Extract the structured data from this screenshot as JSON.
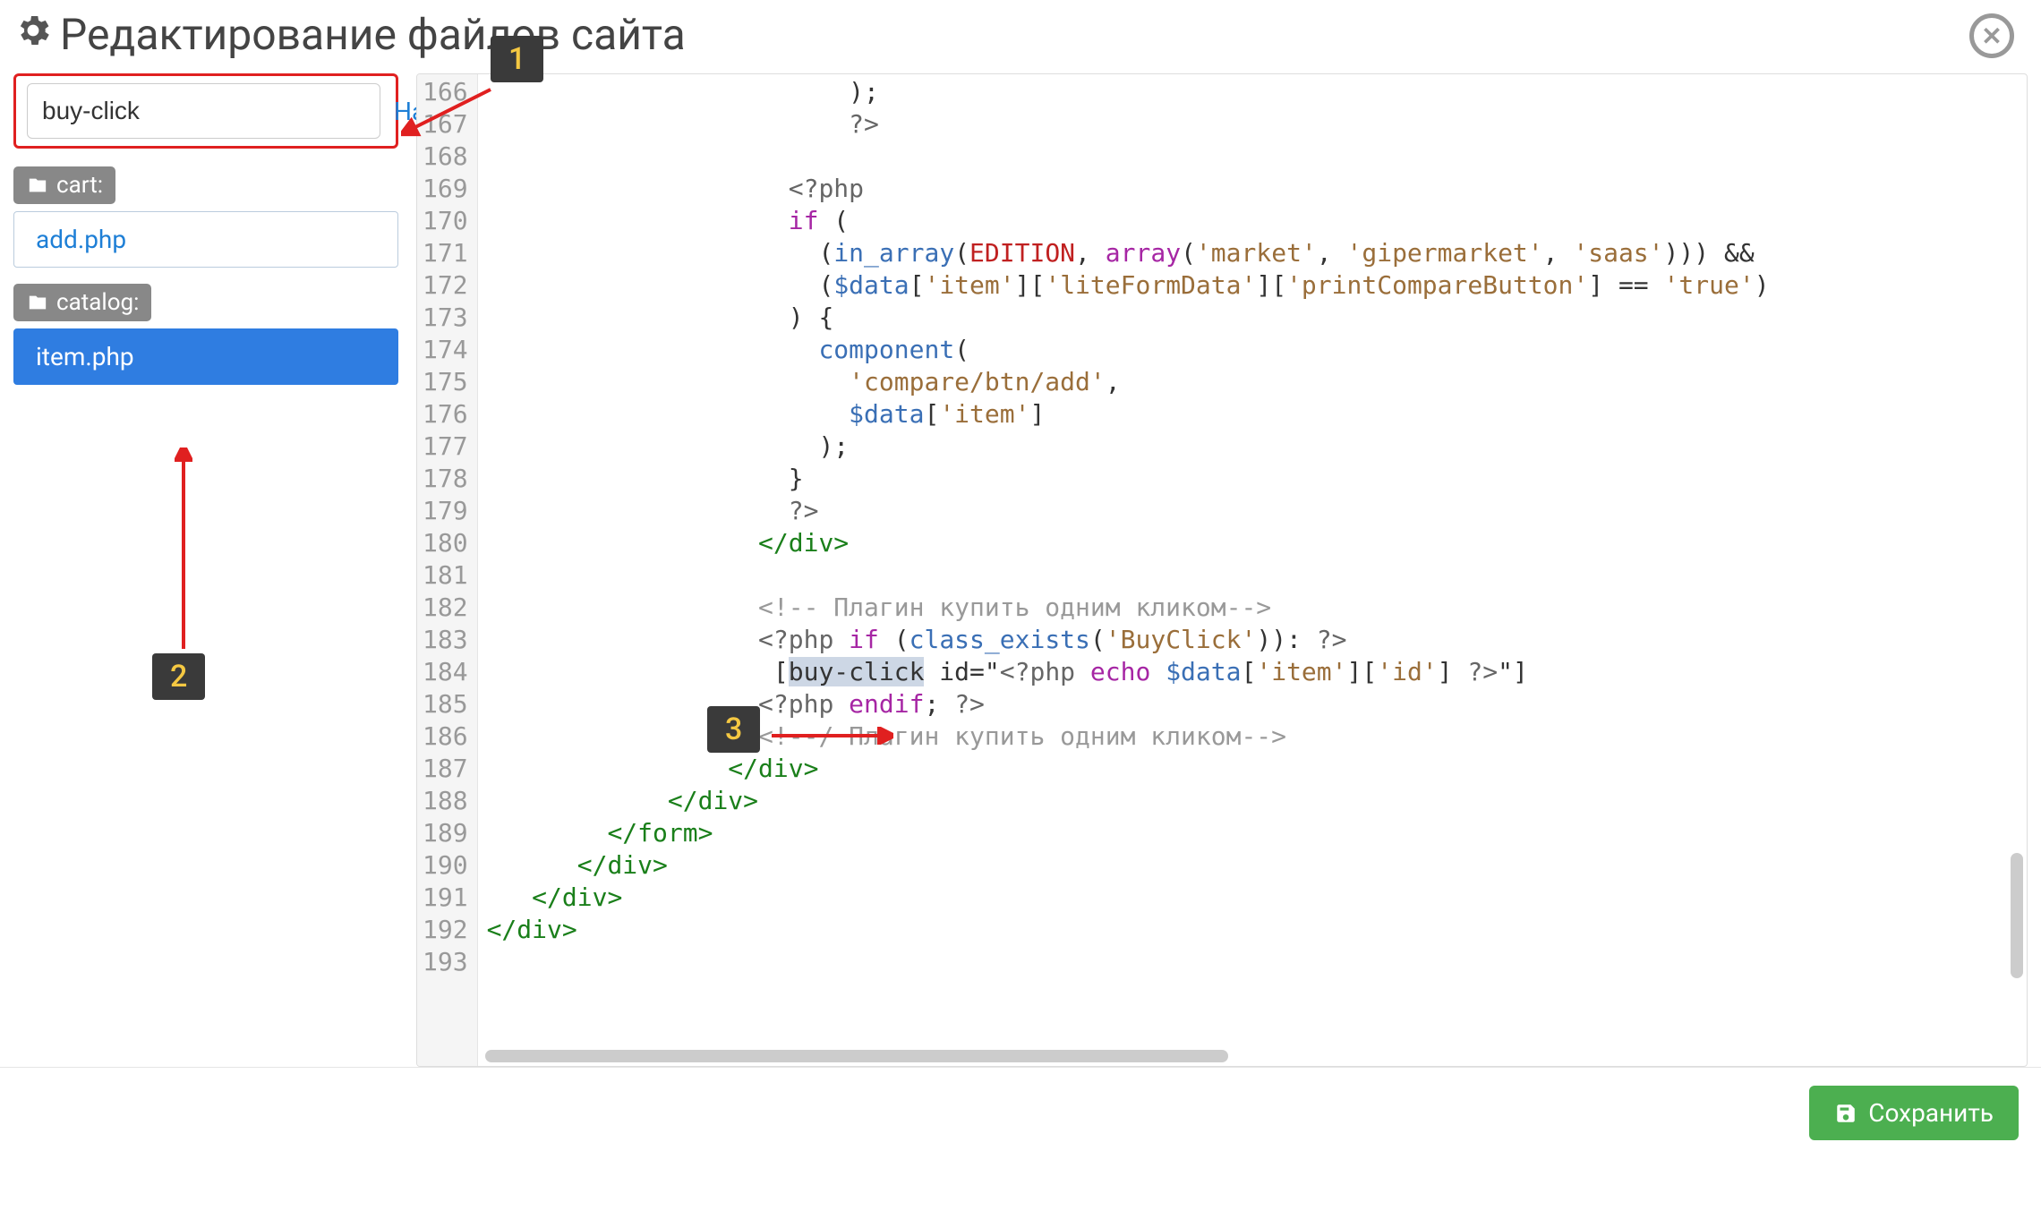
{
  "header": {
    "title": "Редактирование файлов сайта"
  },
  "search": {
    "value": "buy-click",
    "button_label": "Найти"
  },
  "sidebar": {
    "folders": [
      {
        "name": "cart:",
        "files": [
          {
            "name": "add.php",
            "active": false
          }
        ]
      },
      {
        "name": "catalog:",
        "files": [
          {
            "name": "item.php",
            "active": true
          }
        ]
      }
    ]
  },
  "editor": {
    "first_line": 166,
    "lines": [
      "                        );",
      "                        ?>",
      "",
      "                    <?php",
      "                    if (",
      "                      (in_array(EDITION, array('market', 'gipermarket', 'saas'))) &&",
      "                      ($data['item']['liteFormData']['printCompareButton'] == 'true')",
      "                    ) {",
      "                      component(",
      "                        'compare/btn/add',",
      "                        $data['item']",
      "                      );",
      "                    }",
      "                    ?>",
      "                  </div>",
      "",
      "                  <!-- Плагин купить одним кликом-->",
      "                  <?php if (class_exists('BuyClick')): ?>",
      "                   [buy-click id=\"<?php echo $data['item']['id'] ?>\"]",
      "                  <?php endif; ?>",
      "                  <!--/ Плагин купить одним кликом-->",
      "                </div>",
      "            </div>",
      "        </form>",
      "      </div>",
      "   </div>",
      "</div>",
      ""
    ],
    "highlight_text": "buy-click"
  },
  "footer": {
    "save_label": "Сохранить"
  },
  "annotations": {
    "c1": "1",
    "c2": "2",
    "c3": "3"
  }
}
